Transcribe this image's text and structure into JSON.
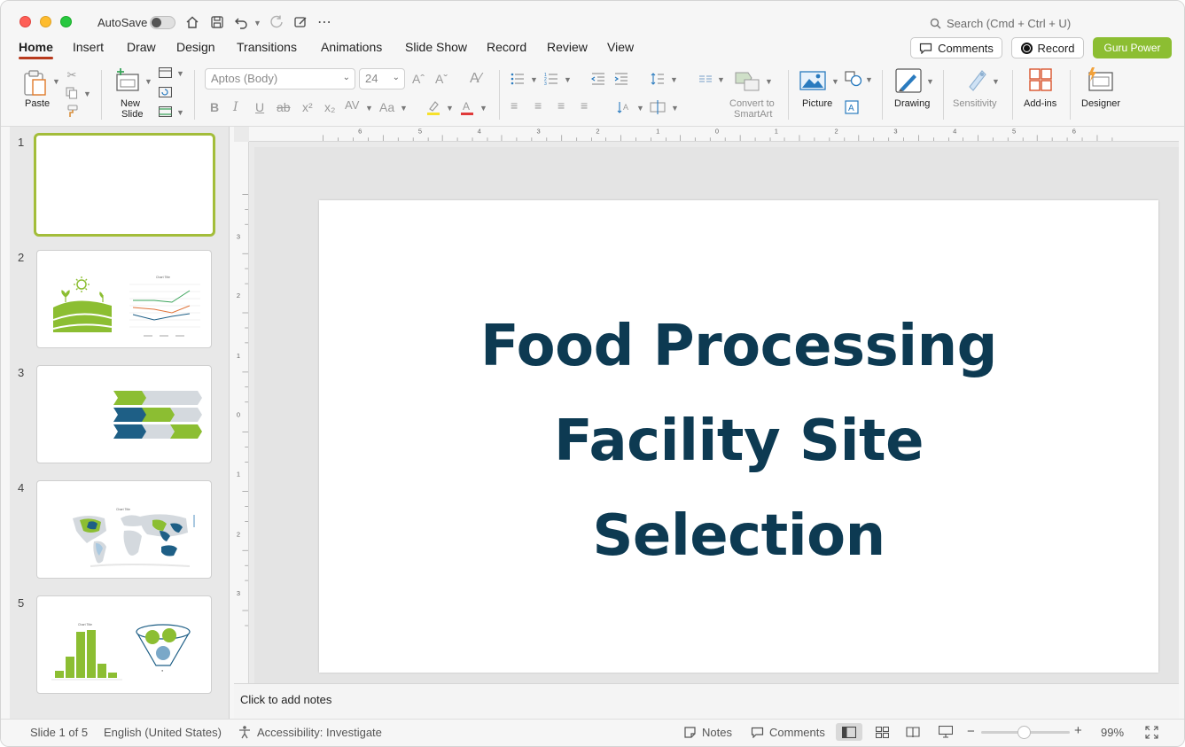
{
  "titlebar": {
    "autosave_label": "AutoSave",
    "search_placeholder": "Search (Cmd + Ctrl + U)"
  },
  "menu": {
    "tabs": [
      "Home",
      "Insert",
      "Draw",
      "Design",
      "Transitions",
      "Animations",
      "Slide Show",
      "Record",
      "Review",
      "View"
    ],
    "active_tab": "Home",
    "comments_label": "Comments",
    "record_label": "Record",
    "guru_label": "Guru Power"
  },
  "ribbon": {
    "paste_label": "Paste",
    "new_slide_label_1": "New",
    "new_slide_label_2": "Slide",
    "font_name": "Aptos (Body)",
    "font_size": "24",
    "convert_label_1": "Convert to",
    "convert_label_2": "SmartArt",
    "picture_label": "Picture",
    "drawing_label": "Drawing",
    "sensitivity_label": "Sensitivity",
    "addins_label": "Add-ins",
    "designer_label": "Designer"
  },
  "thumbnails": [
    {
      "number": "1"
    },
    {
      "number": "2"
    },
    {
      "number": "3"
    },
    {
      "number": "4"
    },
    {
      "number": "5"
    }
  ],
  "slide": {
    "title_line1": "Food Processing",
    "title_line2": "Facility Site",
    "title_line3": "Selection",
    "title_color": "#0d3a52"
  },
  "notes": {
    "placeholder": "Click to add notes"
  },
  "status": {
    "slide_position": "Slide 1 of 5",
    "language": "English (United States)",
    "accessibility": "Accessibility: Investigate",
    "notes_label": "Notes",
    "comments_label": "Comments",
    "zoom_level": "99%"
  },
  "colors": {
    "accent_green": "#8cbe32",
    "dark_blue": "#0d3a52",
    "mid_blue": "#1e5f86",
    "light_gray": "#d4d9de",
    "selection_border": "#a3bd3a"
  }
}
